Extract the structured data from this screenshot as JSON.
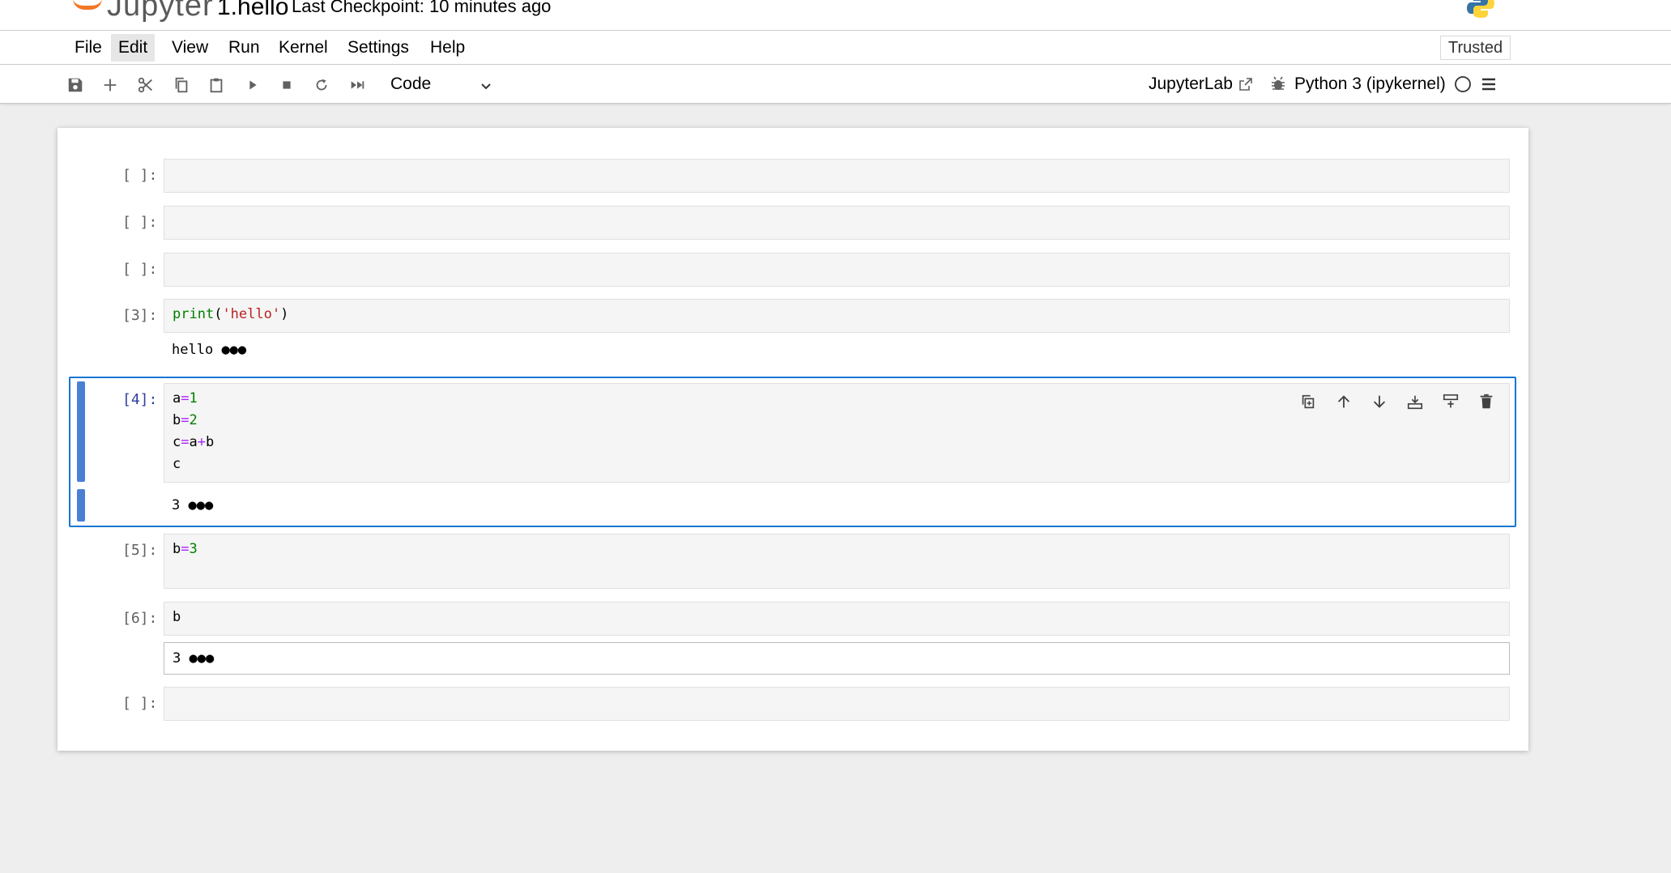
{
  "header": {
    "logo_text": "Jupyter",
    "notebook_title": "1.hello",
    "checkpoint": "Last Checkpoint: 10 minutes ago"
  },
  "menu": {
    "items": [
      "File",
      "Edit",
      "View",
      "Run",
      "Kernel",
      "Settings",
      "Help"
    ],
    "active_item": "Edit",
    "trusted": "Trusted"
  },
  "toolbar": {
    "icons": [
      "save-icon",
      "add-icon",
      "cut-icon",
      "copy-icon",
      "paste-icon",
      "run-icon",
      "stop-icon",
      "restart-icon",
      "fast-forward-icon"
    ],
    "cell_type": "Code",
    "jupyterlab_link": "JupyterLab",
    "kernel_name": "Python 3 (ipykernel)"
  },
  "cells": [
    {
      "prompt": "[ ]:",
      "code": [],
      "output": null
    },
    {
      "prompt": "[ ]:",
      "code": [],
      "output": null
    },
    {
      "prompt": "[ ]:",
      "code": [],
      "output": null
    },
    {
      "prompt": "[3]:",
      "code": [
        "print('hello')"
      ],
      "output": "hello"
    },
    {
      "prompt": "[4]:",
      "code": [
        "a=1",
        "b=2",
        "c=a+b",
        "c"
      ],
      "output": "3",
      "active": true
    },
    {
      "prompt": "[5]:",
      "code": [
        "b=3"
      ],
      "output": null
    },
    {
      "prompt": "[6]:",
      "code": [
        "b"
      ],
      "output": "3"
    },
    {
      "prompt": "[ ]:",
      "code": [],
      "output": null
    }
  ],
  "cell_toolbar": {
    "icons": [
      "duplicate-icon",
      "move-up-icon",
      "move-down-icon",
      "insert-below-icon",
      "insert-above-icon",
      "delete-icon"
    ]
  },
  "output_overflow_marker": "●●●",
  "colors": {
    "active_border": "#1976d2",
    "collapser": "#4a7fd4",
    "jupyter_orange": "#f37726"
  }
}
